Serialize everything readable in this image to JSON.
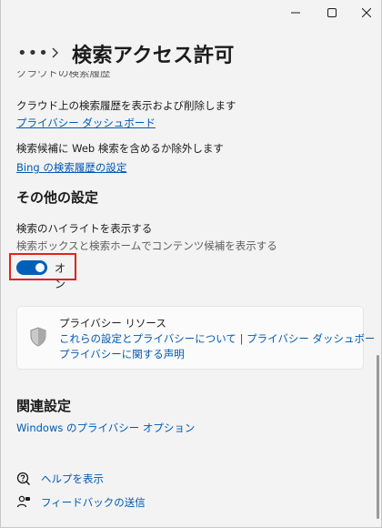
{
  "window": {
    "title": "検索アクセス許可",
    "controls": {
      "minimize": "minimize-icon",
      "maximize": "maximize-icon",
      "close": "close-icon"
    }
  },
  "header": {
    "more": "•••",
    "title": "検索アクセス許可"
  },
  "cloud": {
    "cut_heading": "クラウドの検索履歴",
    "description": "クラウド上の検索履歴を表示および削除します",
    "privacy_dashboard_link": "プライバシー ダッシュボード",
    "web_description": "検索候補に Web 検索を含めるか除外します",
    "bing_link": "Bing の検索履歴の設定"
  },
  "other_settings": {
    "heading": "その他の設定",
    "highlights_title": "検索のハイライトを表示する",
    "highlights_desc": "検索ボックスと検索ホームでコンテンツ候補を表示する",
    "toggle_state": "オン",
    "toggle_on": true
  },
  "privacy_resources": {
    "title": "プライバシー リソース",
    "link_line1": "これらの設定とプライバシーについて | プライバシー ダッシュボード |",
    "link_line2": "プライバシーに関する声明"
  },
  "related": {
    "heading": "関連設定",
    "windows_privacy_link": "Windows のプライバシー オプション"
  },
  "footer": {
    "help": "ヘルプを表示",
    "feedback": "フィードバックの送信"
  },
  "colors": {
    "accent": "#005fb8",
    "link": "#0059b3",
    "highlight_box": "#e0241c"
  }
}
